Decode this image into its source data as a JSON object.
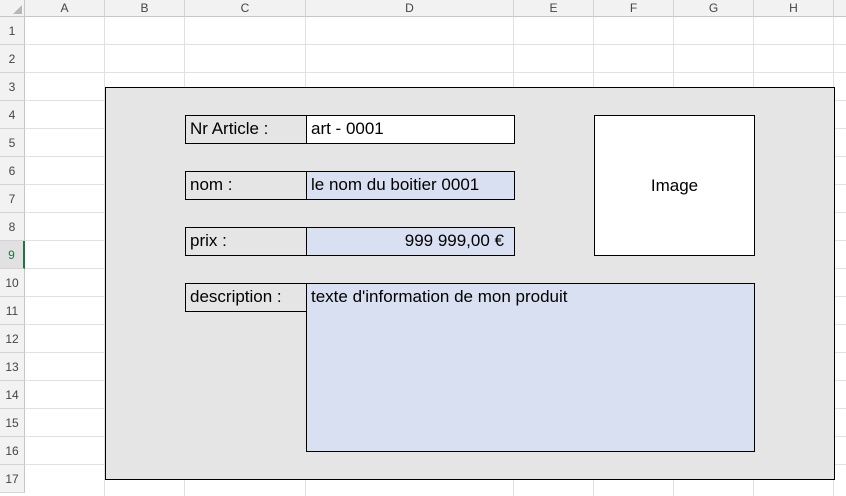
{
  "columns": [
    "A",
    "B",
    "C",
    "D",
    "E",
    "F",
    "G",
    "H"
  ],
  "rows": [
    "1",
    "2",
    "3",
    "4",
    "5",
    "6",
    "7",
    "8",
    "9",
    "10",
    "11",
    "12",
    "13",
    "14",
    "15",
    "16",
    "17"
  ],
  "active_row": "9",
  "form": {
    "article_label": "Nr Article :",
    "article_value": "art - 0001",
    "nom_label": "nom :",
    "nom_value": "le nom du boitier 0001",
    "prix_label": "prix :",
    "prix_value": "999 999,00 €",
    "description_label": "description :",
    "description_value": "texte d'information de mon produit",
    "image_label": "Image"
  },
  "colors": {
    "panel_bg": "#e5e5e5",
    "field_blue": "#d9e0f1",
    "header_bg": "#f2f2f2",
    "active_accent": "#217346"
  }
}
